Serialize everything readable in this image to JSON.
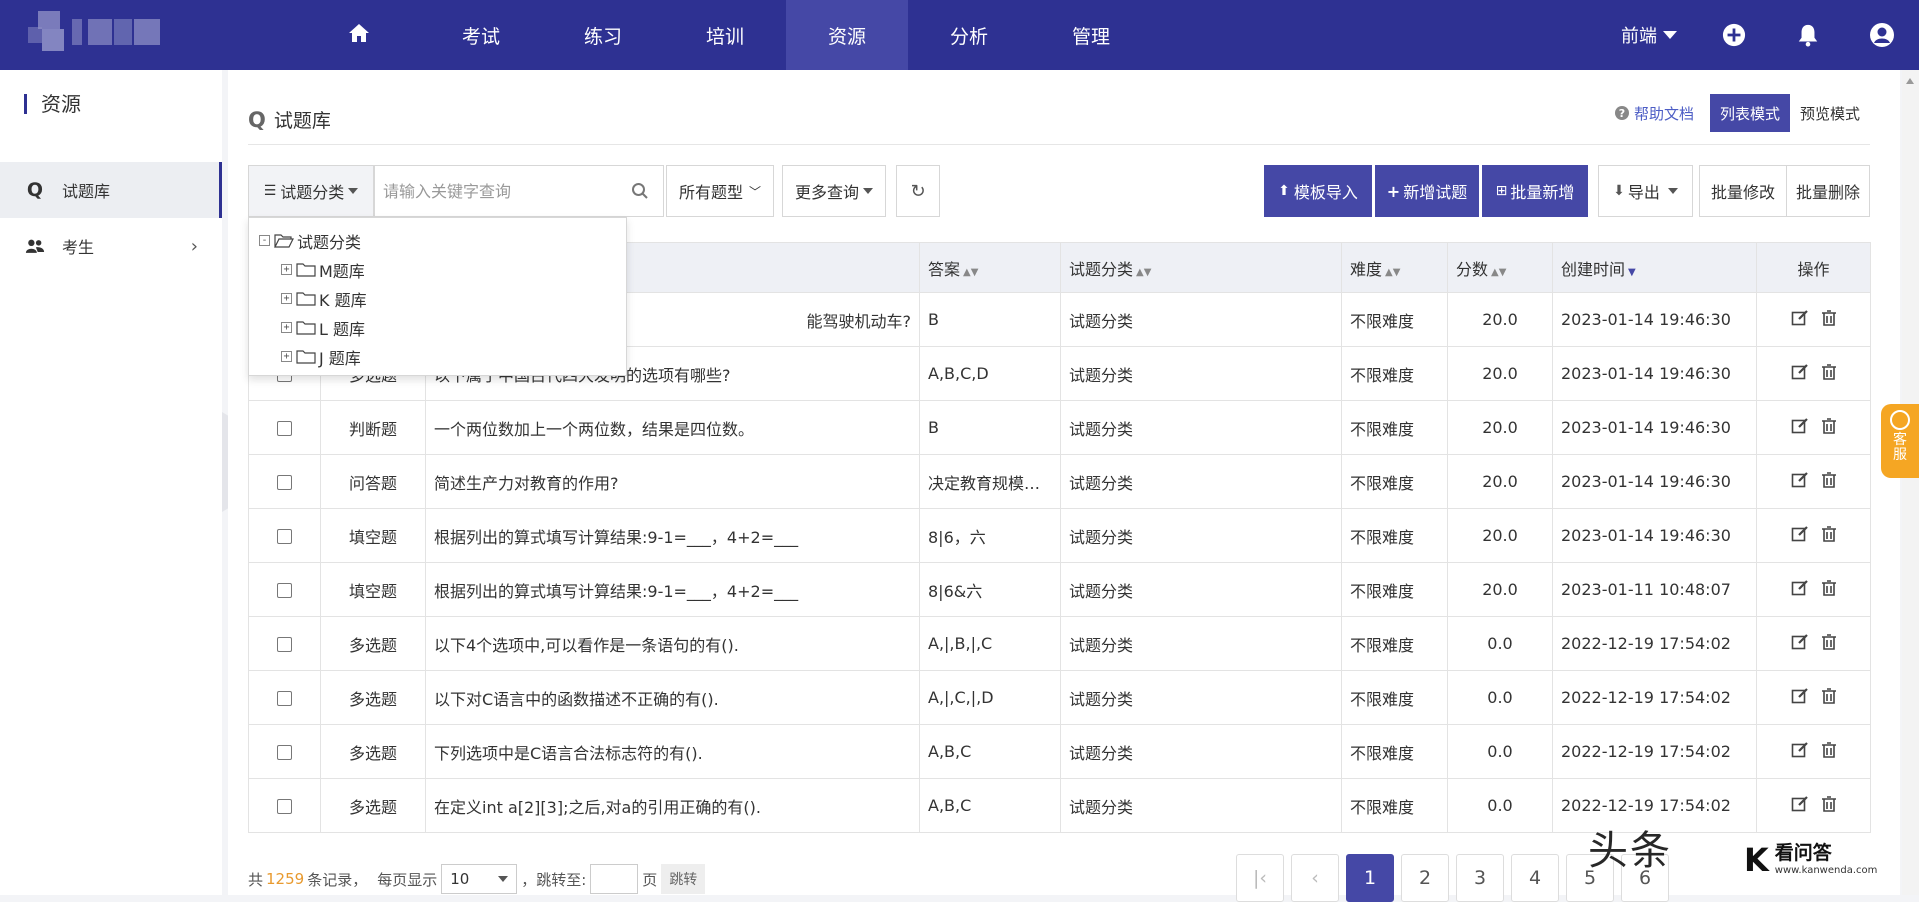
{
  "nav": {
    "home_icon": "home-icon",
    "items": [
      "考试",
      "练习",
      "培训",
      "资源",
      "分析",
      "管理"
    ],
    "active": "资源",
    "role_dropdown": "前端",
    "icons": [
      "plus-circle-icon",
      "bell-icon",
      "user-icon"
    ]
  },
  "sidebar": {
    "title": "资源",
    "items": [
      {
        "label": "试题库",
        "icon": "search-q-icon"
      },
      {
        "label": "考生",
        "icon": "users-icon"
      }
    ]
  },
  "header": {
    "title": "试题库",
    "help": "帮助文档",
    "modes": [
      "列表模式",
      "预览模式"
    ]
  },
  "toolbar": {
    "category_btn": "试题分类",
    "search_placeholder": "请输入关键字查询",
    "type_select": "所有题型",
    "more_query": "更多查询",
    "import": "模板导入",
    "add": "新增试题",
    "batch_add": "批量新增",
    "export": "导出",
    "batch_edit": "批量修改",
    "batch_delete": "批量删除"
  },
  "tree": {
    "root": "试题分类",
    "children": [
      "M题库",
      "K 题库",
      "L 题库",
      "J 题库"
    ]
  },
  "table": {
    "headers": {
      "answer": "答案",
      "category": "试题分类",
      "difficulty": "难度",
      "score": "分数",
      "created": "创建时间",
      "actions": "操作"
    },
    "rows": [
      {
        "type": "",
        "question": "能驾驶机动车?",
        "answer": "B",
        "category": "试题分类",
        "difficulty": "不限难度",
        "score": "20.0",
        "created": "2023-01-14 19:46:30"
      },
      {
        "type": "多选题",
        "question": "以下属于中国古代四大发明的选项有哪些?",
        "answer": "A,B,C,D",
        "category": "试题分类",
        "difficulty": "不限难度",
        "score": "20.0",
        "created": "2023-01-14 19:46:30"
      },
      {
        "type": "判断题",
        "question": "一个两位数加上一个两位数，结果是四位数。",
        "answer": "B",
        "category": "试题分类",
        "difficulty": "不限难度",
        "score": "20.0",
        "created": "2023-01-14 19:46:30"
      },
      {
        "type": "问答题",
        "question": "简述生产力对教育的作用?",
        "answer": "决定教育规模和...",
        "category": "试题分类",
        "difficulty": "不限难度",
        "score": "20.0",
        "created": "2023-01-14 19:46:30"
      },
      {
        "type": "填空题",
        "question": "根据列出的算式填写计算结果:9-1=___，4+2=___",
        "answer": "8|6，六",
        "category": "试题分类",
        "difficulty": "不限难度",
        "score": "20.0",
        "created": "2023-01-14 19:46:30"
      },
      {
        "type": "填空题",
        "question": "根据列出的算式填写计算结果:9-1=___，4+2=___",
        "answer": "8|6&六",
        "category": "试题分类",
        "difficulty": "不限难度",
        "score": "20.0",
        "created": "2023-01-11 10:48:07"
      },
      {
        "type": "多选题",
        "question": "以下4个选项中,可以看作是一条语句的有().",
        "answer": "A,|,B,|,C",
        "category": "试题分类",
        "difficulty": "不限难度",
        "score": "0.0",
        "created": "2022-12-19 17:54:02"
      },
      {
        "type": "多选题",
        "question": "以下对C语言中的函数描述不正确的有().",
        "answer": "A,|,C,|,D",
        "category": "试题分类",
        "difficulty": "不限难度",
        "score": "0.0",
        "created": "2022-12-19 17:54:02"
      },
      {
        "type": "多选题",
        "question": "下列选项中是C语言合法标志符的有().",
        "answer": "A,B,C",
        "category": "试题分类",
        "difficulty": "不限难度",
        "score": "0.0",
        "created": "2022-12-19 17:54:02"
      },
      {
        "type": "多选题",
        "question": "在定义int  a[2][3];之后,对a的引用正确的有().",
        "answer": "A,B,C",
        "category": "试题分类",
        "difficulty": "不限难度",
        "score": "0.0",
        "created": "2022-12-19 17:54:02"
      }
    ]
  },
  "footer": {
    "total_prefix": "共",
    "total": "1259",
    "total_suffix": "条记录，",
    "per_page_label": "每页显示",
    "per_page": "10",
    "jump_label": "，跳转至:",
    "page_unit": "页",
    "jump_btn": "跳转",
    "pages": [
      "1",
      "2",
      "3",
      "4",
      "5",
      "6"
    ],
    "current_page": "1"
  },
  "widgets": {
    "kefu": "客服",
    "watermark_toutiao": "头条",
    "watermark_site": "看问答",
    "watermark_url": "www.kanwenda.com"
  },
  "colors": {
    "primary": "#2e3192",
    "accent": "#4548a6",
    "highlight": "#e89a2f",
    "kefu": "#f5a623"
  }
}
